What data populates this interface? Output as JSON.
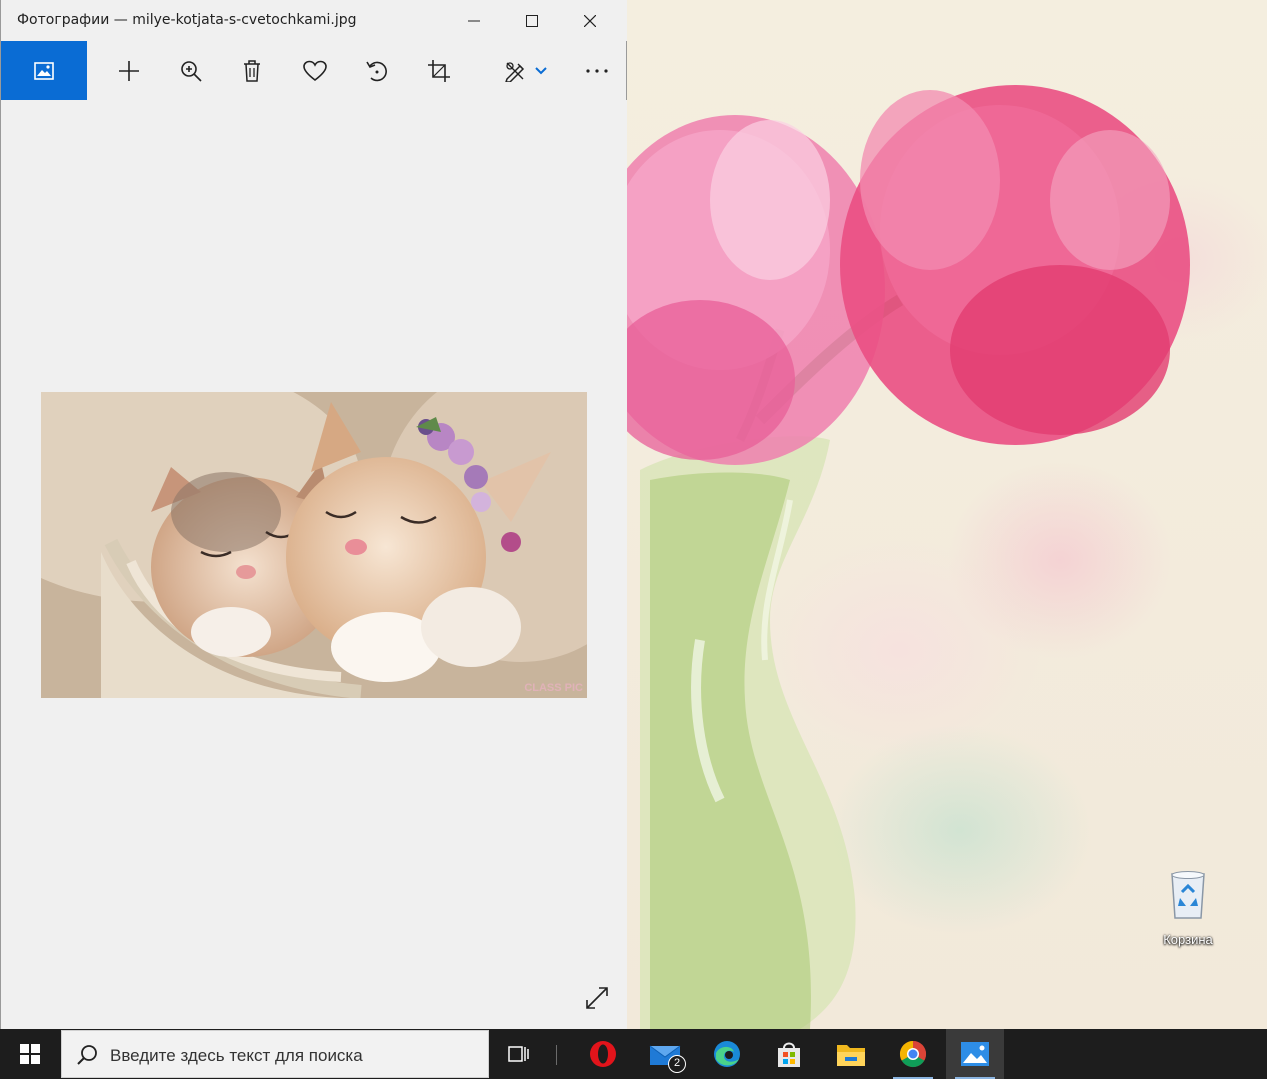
{
  "window": {
    "title": "Фотографии — milye-kotjata-s-cvetochkami.jpg",
    "caption_buttons": [
      "minimize",
      "maximize",
      "close"
    ]
  },
  "toolbar": {
    "active_tab_icon": "photo-collection-icon",
    "tools": [
      "add-icon",
      "zoom-in-icon",
      "delete-icon",
      "favorite-icon",
      "rotate-icon",
      "crop-icon",
      "edit-draw-icon",
      "chevron-down-icon",
      "more-icon"
    ],
    "accent_color": "#0a6cd4"
  },
  "viewer": {
    "watermark": "CLASS PIC",
    "fullscreen_icon": "fullscreen-expand-icon"
  },
  "desktop": {
    "recycle_bin_label": "Корзина"
  },
  "taskbar": {
    "search_placeholder": "Введите здесь текст для поиска",
    "apps": [
      "task-view-icon",
      "opera-icon",
      "mail-icon",
      "edge-icon",
      "store-icon",
      "file-explorer-icon",
      "chrome-icon",
      "photos-icon"
    ],
    "mail_badge": "2"
  }
}
